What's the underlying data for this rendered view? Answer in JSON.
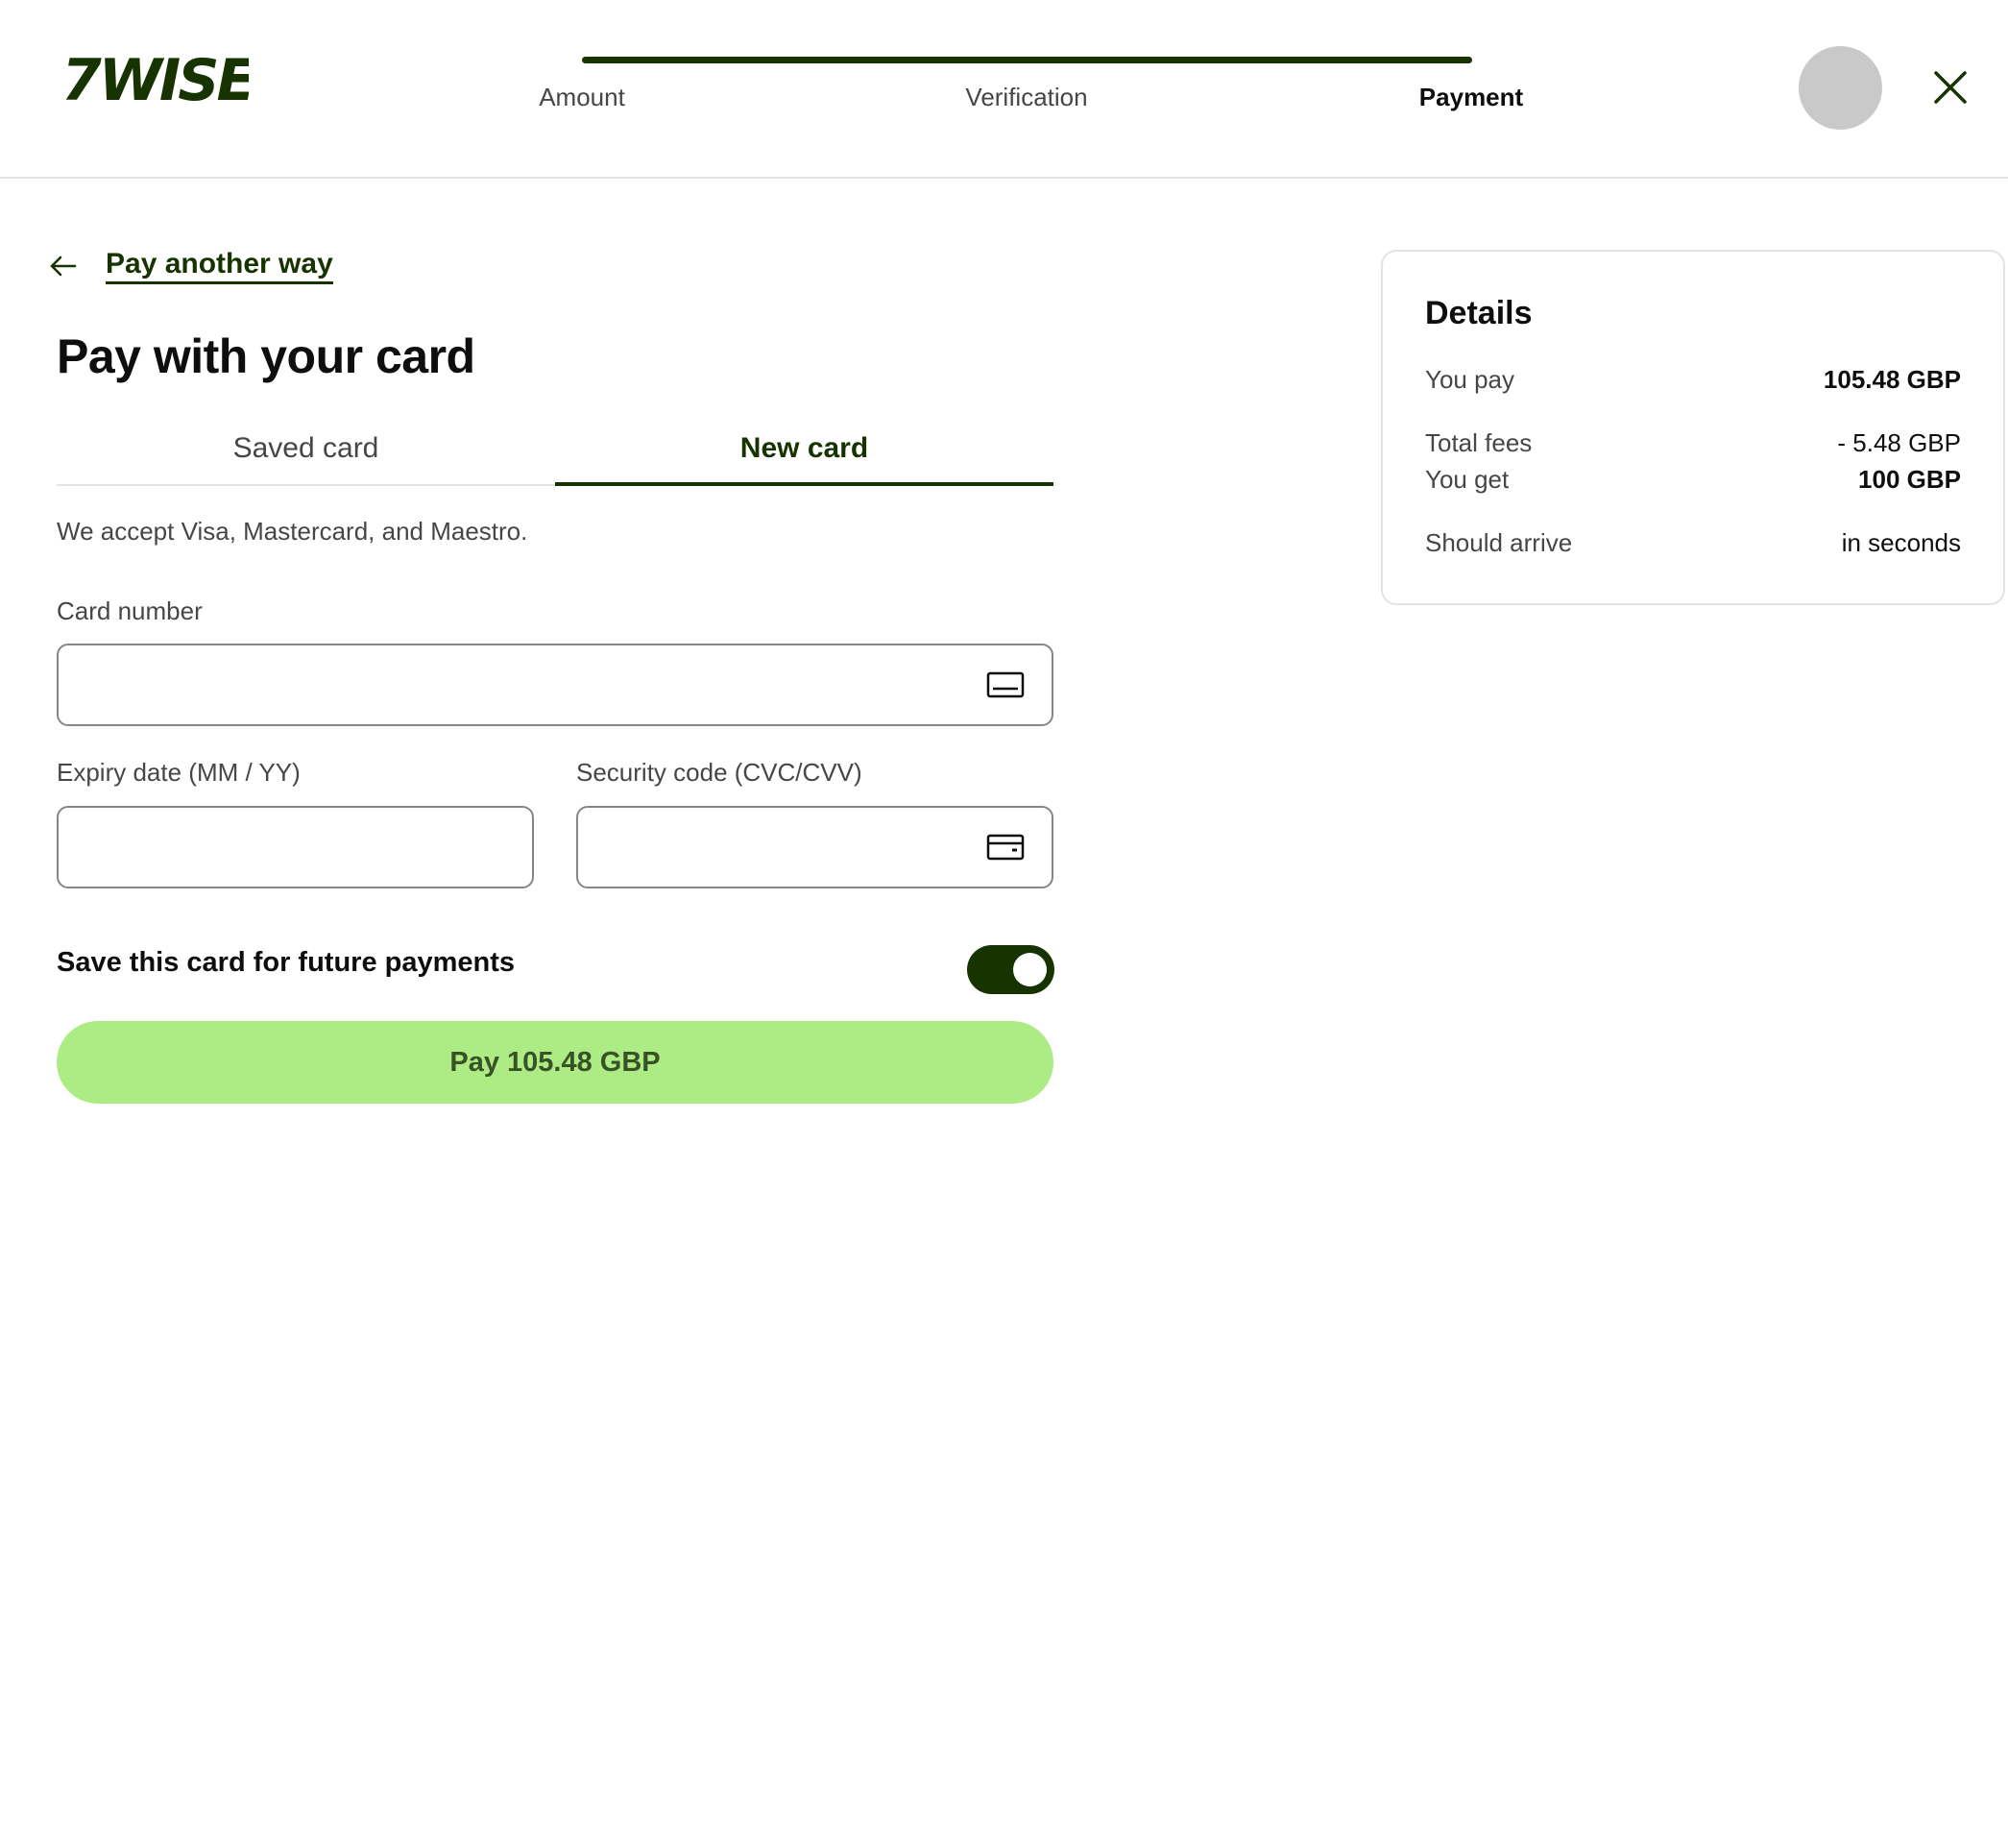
{
  "header": {
    "logo_text": "7WISE",
    "steps": [
      {
        "label": "Amount",
        "active": false
      },
      {
        "label": "Verification",
        "active": false
      },
      {
        "label": "Payment",
        "active": true
      }
    ]
  },
  "main": {
    "back_link": "Pay another way",
    "title": "Pay with your card",
    "tabs": [
      {
        "label": "Saved card",
        "active": false
      },
      {
        "label": "New card",
        "active": true
      }
    ],
    "accept_note": "We accept Visa, Mastercard, and Maestro.",
    "fields": {
      "card_number": {
        "label": "Card number",
        "value": "",
        "icon": "card-number-icon"
      },
      "expiry": {
        "label": "Expiry date (MM / YY)",
        "value": ""
      },
      "security_code": {
        "label": "Security code (CVC/CVV)",
        "value": "",
        "icon": "card-back-icon"
      }
    },
    "save_card": {
      "label": "Save this card for future payments",
      "enabled": true
    },
    "pay_button": "Pay 105.48 GBP"
  },
  "details": {
    "title": "Details",
    "rows": [
      {
        "label": "You pay",
        "value": "105.48 GBP",
        "bold": true
      },
      {
        "label": "Total fees",
        "value": "- 5.48 GBP",
        "bold": false
      },
      {
        "label": "You get",
        "value": "100 GBP",
        "bold": true
      },
      {
        "label": "Should arrive",
        "value": "in seconds",
        "bold": false
      }
    ]
  },
  "colors": {
    "brand_dark": "#163300",
    "brand_green": "#9fe870"
  }
}
